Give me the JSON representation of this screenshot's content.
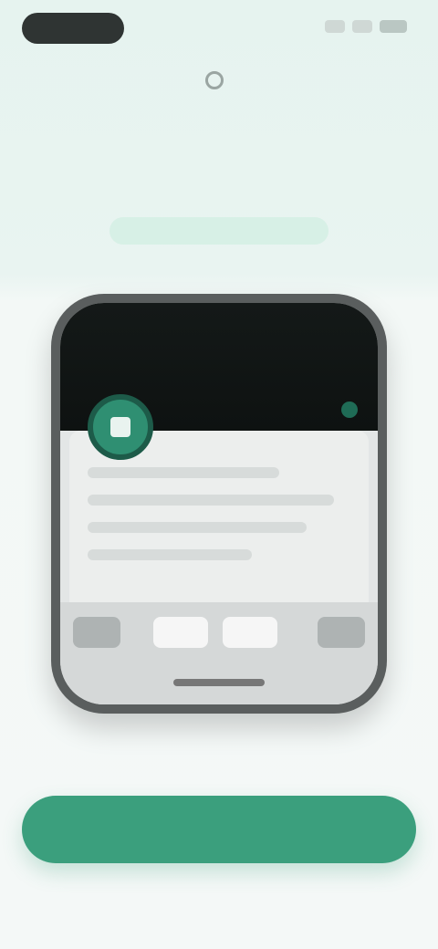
{
  "status_bar": {
    "time": "",
    "icons": [
      "signal-icon",
      "wifi-icon",
      "battery-icon"
    ]
  },
  "brand": {
    "name": "",
    "icon": "brand-mark-icon"
  },
  "headline": "",
  "subhead": "",
  "phone": {
    "avatar_icon": "app-icon"
  },
  "cta": {
    "label": ""
  },
  "footer": {
    "links": [
      "",
      ""
    ]
  },
  "colors": {
    "accent": "#3b9f7d",
    "background": "#e9f4f1",
    "text": "#3a3f3e"
  }
}
